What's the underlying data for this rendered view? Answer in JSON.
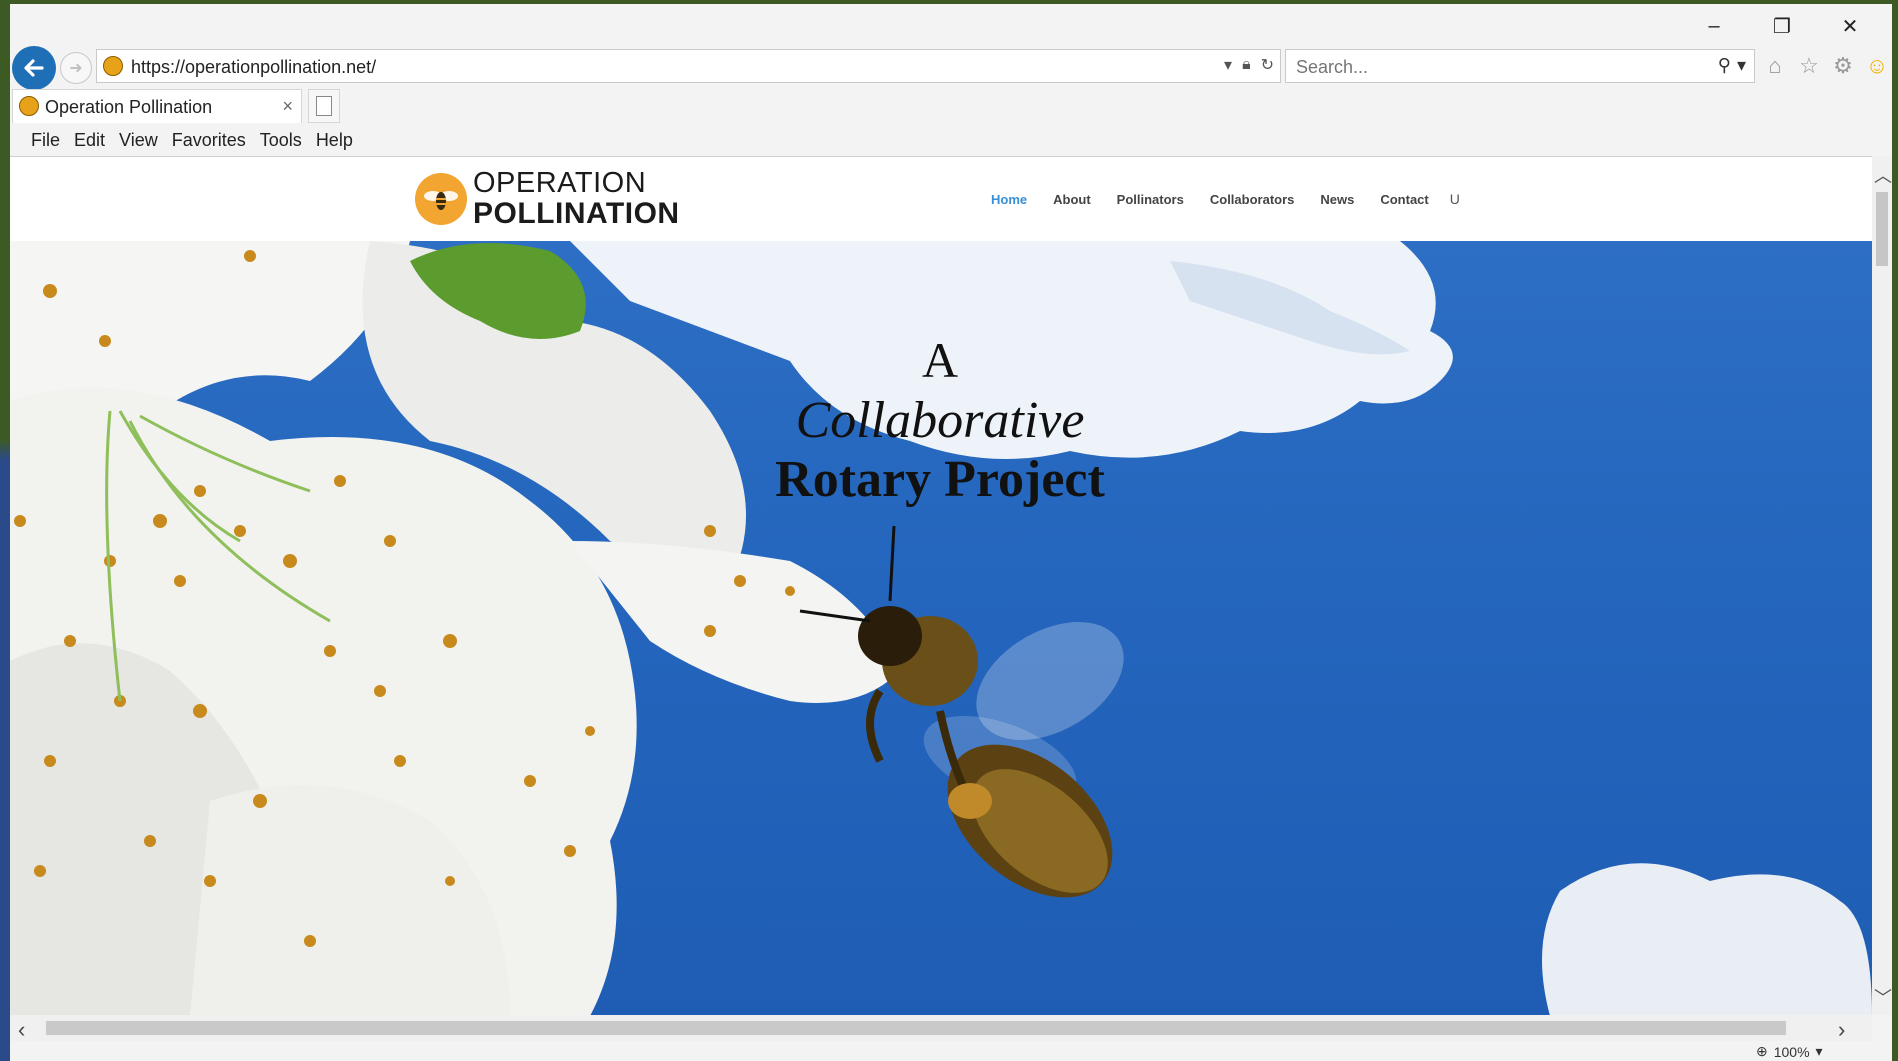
{
  "browser": {
    "url": "https://operationpollination.net/",
    "search_placeholder": "Search...",
    "tab_title": "Operation Pollination",
    "tab_close": "×",
    "window_controls": {
      "minimize": "–",
      "restore": "❐",
      "close": "✕"
    },
    "menu": [
      "File",
      "Edit",
      "View",
      "Favorites",
      "Tools",
      "Help"
    ],
    "zoom": "100%"
  },
  "site": {
    "logo_line1": "OPERATION",
    "logo_line2": "POLLINATION",
    "nav": [
      {
        "label": "Home",
        "active": true
      },
      {
        "label": "About"
      },
      {
        "label": "Pollinators"
      },
      {
        "label": "Collaborators"
      },
      {
        "label": "News"
      },
      {
        "label": "Contact"
      }
    ],
    "nav_extra": "U",
    "hero": {
      "line1": "A",
      "line2": "Collaborative",
      "line3": "Rotary Project"
    }
  },
  "colors": {
    "accent": "#3b8fd4",
    "logo_orange": "#f2a531",
    "sky": "#2465bd",
    "back_button": "#1f6fb7"
  }
}
